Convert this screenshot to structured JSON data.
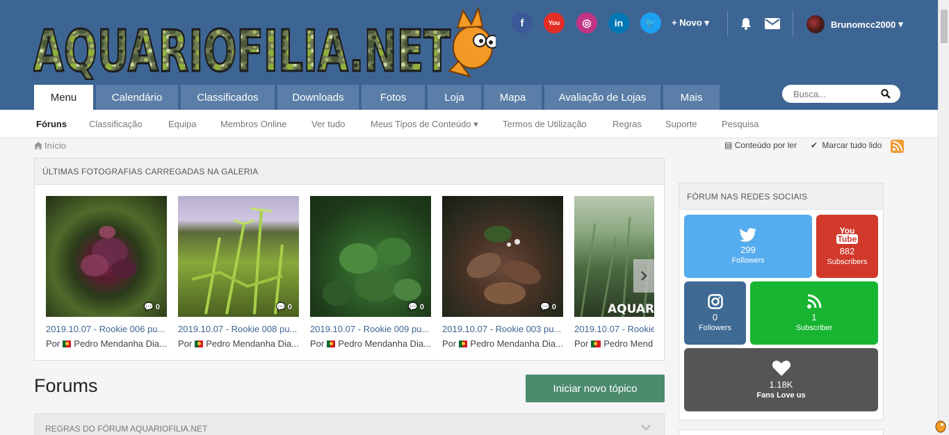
{
  "header": {
    "logo_text": "AQUARIOFILIA.NET",
    "social_icons": [
      {
        "name": "facebook-icon",
        "glyph": "f",
        "color": "#3b5998"
      },
      {
        "name": "youtube-icon",
        "glyph": "You",
        "color": "#e52d27"
      },
      {
        "name": "instagram-icon",
        "glyph": "◎",
        "color": "#c13584"
      },
      {
        "name": "linkedin-icon",
        "glyph": "in",
        "color": "#0077b5"
      },
      {
        "name": "twitter-icon",
        "glyph": "🐦",
        "color": "#1da1f2"
      }
    ],
    "novo_label": "Novo",
    "user_name": "Brunomcc2000"
  },
  "main_nav": {
    "tabs": [
      "Menu",
      "Calendário",
      "Classificados",
      "Downloads",
      "Fotos",
      "Loja",
      "Mapa",
      "Avaliação de Lojas",
      "Mais"
    ],
    "active": "Menu"
  },
  "search": {
    "placeholder": "Busca..."
  },
  "sub_nav": {
    "items": [
      "Fóruns",
      "Classificação",
      "Equipa",
      "Membros Online",
      "Ver tudo",
      "Meus Tipos de Conteúdo",
      "Termos de Utilização",
      "Regras",
      "Suporte",
      "Pesquisa"
    ],
    "active": "Fóruns"
  },
  "breadcrumb": {
    "home": "Início"
  },
  "actions": {
    "unread": "Conteúdo por ler",
    "mark_read": "Marcar tudo lido"
  },
  "gallery": {
    "heading": "ÚLTIMAS FOTOGRAFIAS CARREGADAS NA GALERIA",
    "photos": [
      {
        "title": "2019.10.07 - Rookie 006 pu...",
        "by": "Por",
        "author": "Pedro Mendanha Dia...",
        "comments": "0"
      },
      {
        "title": "2019.10.07 - Rookie 008 pu...",
        "by": "Por",
        "author": "Pedro Mendanha Dia...",
        "comments": "0"
      },
      {
        "title": "2019.10.07 - Rookie 009 pu...",
        "by": "Por",
        "author": "Pedro Mendanha Dia...",
        "comments": "0"
      },
      {
        "title": "2019.10.07 - Rookie 003 pu...",
        "by": "Por",
        "author": "Pedro Mendanha Dia...",
        "comments": "0"
      },
      {
        "title": "2019.10.07 - Rookie",
        "by": "Por",
        "author": "Pedro Mend",
        "comments": ""
      }
    ],
    "watermark": "AQUARIO"
  },
  "forums": {
    "title": "Forums",
    "new_topic": "Iniciar novo tópico",
    "rules_heading": "REGRAS DO FÓRUM AQUARIOFILIA.NET"
  },
  "social_widget": {
    "heading": "FÓRUM NAS REDES SOCIAIS",
    "boxes": [
      {
        "name": "twitter",
        "icon": "twitter-icon",
        "count": "299",
        "label": "Followers",
        "color": "#55acee"
      },
      {
        "name": "youtube",
        "icon": "youtube-icon",
        "count": "882",
        "label": "Subscribers",
        "color": "#d1392b"
      },
      {
        "name": "instagram",
        "icon": "instagram-icon",
        "count": "0",
        "label": "Followers",
        "color": "#3e6a94"
      },
      {
        "name": "rss",
        "icon": "rss-icon",
        "count": "1",
        "label": "Subscriber",
        "color": "#17b531"
      },
      {
        "name": "fans",
        "icon": "heart-icon",
        "count": "1.18K",
        "label": "Fans Love us",
        "color": "#555555"
      }
    ]
  }
}
